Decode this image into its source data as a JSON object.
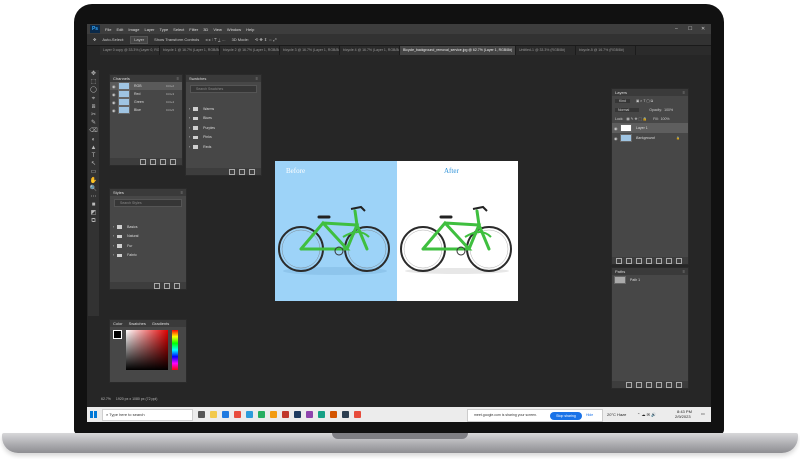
{
  "app": {
    "logo": "Ps",
    "menu": [
      "File",
      "Edit",
      "Image",
      "Layer",
      "Type",
      "Select",
      "Filter",
      "3D",
      "View",
      "Window",
      "Help"
    ]
  },
  "window_controls": [
    "–",
    "☐",
    "✕"
  ],
  "options_bar": {
    "auto_select": "Auto-Select:",
    "layer": "Layer",
    "show_transform": "Show Transform Controls",
    "mode3d": "3D Mode:"
  },
  "doc_tabs": [
    "Layer 0 copy @ 33.3% (Layer 0, RGB/8#)",
    "bicycle 1 @ 16.7% (Layer 1, RGB/8#)",
    "bicycle 2 @ 16.7% (Layer 1, RGB/8#)",
    "bicycle 3 @ 16.7% (Layer 1, RGB/8#)",
    "bicycle 4 @ 16.7% (Layer 1, RGB/8#)",
    "Bicycle_background_removal_service.jpg @ 62.7% (Layer 1, RGB/8#)",
    "Untitled-1 @ 33.3% (RGB/8#)",
    "bicycle-5 @ 16.7% (RGB/8#)"
  ],
  "tools": [
    "✥",
    "⬚",
    "◯",
    "⌖",
    "⧈",
    "✂",
    "✎",
    "⌫",
    "◐",
    "▲",
    "T",
    "↖",
    "▭",
    "✋",
    "🔍",
    "⋯",
    "■",
    "◩",
    "⧉"
  ],
  "channels_panel": {
    "title": "Channels",
    "rows": [
      {
        "name": "RGB",
        "shortcut": "Ctrl+2"
      },
      {
        "name": "Red",
        "shortcut": "Ctrl+3"
      },
      {
        "name": "Green",
        "shortcut": "Ctrl+4"
      },
      {
        "name": "Blue",
        "shortcut": "Ctrl+5"
      }
    ]
  },
  "swatches_panel": {
    "title": "Swatches",
    "search": "Search Swatches",
    "folders": [
      "Warms",
      "Blues",
      "Purples",
      "Pinks",
      "Reds"
    ]
  },
  "styles_panel": {
    "title": "Styles",
    "search": "Search Styles",
    "folders": [
      "Basics",
      "Natural",
      "Fur",
      "Fabric"
    ]
  },
  "color_panel": {
    "tabs": [
      "Color",
      "Swatches",
      "Gradients"
    ]
  },
  "status_bar": {
    "zoom": "62.7%",
    "doc_size": "1920 px x 1080 px (72 ppi)"
  },
  "canvas": {
    "before_label": "Before",
    "after_label": "After",
    "before_bg": "#9dd3f8",
    "bike_color": "#3fbf3f"
  },
  "layers_panel": {
    "title": "Layers",
    "kind": "Kind",
    "blend": "Normal",
    "opacity_label": "Opacity:",
    "opacity": "100%",
    "lock_label": "Lock:",
    "fill_label": "Fill:",
    "fill": "100%",
    "layers": [
      {
        "name": "Layer 1"
      },
      {
        "name": "Background"
      }
    ]
  },
  "paths_panel": {
    "title": "Paths",
    "rows": [
      "Path 1"
    ]
  },
  "taskbar": {
    "search": "Type here to search",
    "share_text": "meet.google.com is sharing your screen.",
    "stop": "Stop sharing",
    "hide": "Hide",
    "weather": "20°C Haze",
    "time": "8:43 PM",
    "date": "2/9/2023"
  }
}
